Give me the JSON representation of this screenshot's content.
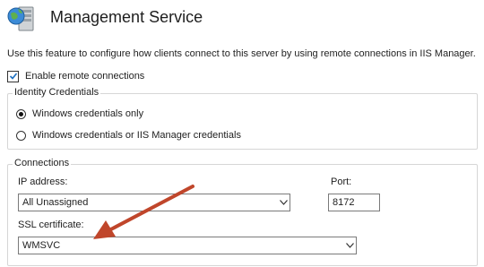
{
  "header": {
    "title": "Management Service",
    "icon": "server-globe-icon"
  },
  "description": "Use this feature to configure how clients connect to this server by using remote connections in IIS Manager.",
  "enable_remote": {
    "label": "Enable remote connections",
    "checked": true
  },
  "identity": {
    "legend": "Identity Credentials",
    "options": [
      {
        "label": "Windows credentials only",
        "selected": true
      },
      {
        "label": "Windows credentials or IIS Manager credentials",
        "selected": false
      }
    ]
  },
  "connections": {
    "legend": "Connections",
    "ip_label": "IP address:",
    "ip_value": "All Unassigned",
    "port_label": "Port:",
    "port_value": "8172",
    "ssl_label": "SSL certificate:",
    "ssl_value": "WMSVC"
  },
  "annotation": {
    "arrow_color": "#c0462b"
  }
}
